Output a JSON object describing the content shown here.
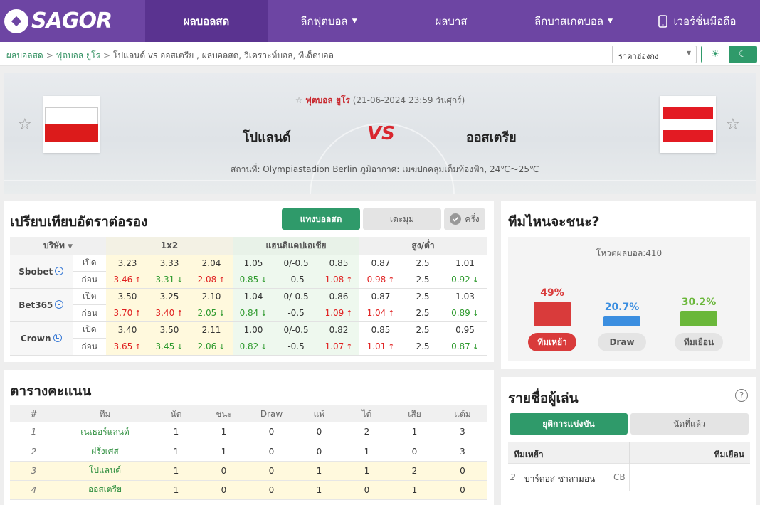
{
  "nav": {
    "logo": "SAGOR",
    "items": [
      {
        "label": "ผลบอลสด",
        "active": true
      },
      {
        "label": "ลีกฟุตบอล",
        "dropdown": true
      },
      {
        "label": "ผลบาส"
      },
      {
        "label": "ลีกบาสเกตบอล",
        "dropdown": true
      },
      {
        "label": "เวอร์ชั่นมือถือ",
        "icon": "phone-icon"
      }
    ]
  },
  "breadcrumb": [
    "ผลบอลสด",
    "ฟุตบอล ยูโร",
    "โปแลนด์ vs  ออสเตรีย ,  ผลบอลสด,  วิเคราะห์บอล,  ทีเด็ดบอล"
  ],
  "price_select": {
    "value": "ราคาฮ่องกง"
  },
  "theme_toggle": {
    "light_icon": "sun-icon",
    "dark_icon": "moon-icon"
  },
  "match": {
    "league": "ฟุตบอล ยูโร",
    "datetime": "(21-06-2024 23:59 วันศุกร์)",
    "home": "โปแลนด์",
    "away": "ออสเตรีย",
    "vs": "VS",
    "venue": "สถานที่: Olympiastadion Berlin",
    "weather": "ภูมิอากาศ: เมฆปกคลุมเต็มท้องฟ้า, 24℃～25℃",
    "home_flag_colors": [
      "#ffffff",
      "#dc1b1b"
    ],
    "away_flag_colors": [
      "#e31b23",
      "#ffffff",
      "#e31b23"
    ]
  },
  "odds": {
    "title": "เปรียบเทียบอัตราต่อรอง",
    "buttons": {
      "live": "แทงบอลสด",
      "hidden": "เดะมุม",
      "half": "ครึ่ง"
    },
    "headers": {
      "company": "บริษัท",
      "x12": "1x2",
      "handicap": "แฮนดิแคปเอเชีย",
      "ou": "สูง/ต่ำ"
    },
    "row_labels": {
      "open": "เปิด",
      "before": "ก่อน"
    },
    "books": [
      {
        "name": "Sbobet",
        "open": [
          "3.23",
          "3.33",
          "2.04",
          "1.05",
          "0/-0.5",
          "0.85",
          "0.87",
          "2.5",
          "1.01"
        ],
        "before": [
          "3.46",
          "3.31",
          "2.08",
          "0.85",
          "-0.5",
          "1.08",
          "0.98",
          "2.5",
          "0.92"
        ],
        "before_dir": [
          "up",
          "dn",
          "up",
          "dn",
          "",
          "up",
          "up",
          "",
          "dn"
        ]
      },
      {
        "name": "Bet365",
        "open": [
          "3.50",
          "3.25",
          "2.10",
          "1.04",
          "0/-0.5",
          "0.86",
          "0.87",
          "2.5",
          "1.03"
        ],
        "before": [
          "3.70",
          "3.40",
          "2.05",
          "0.84",
          "-0.5",
          "1.09",
          "1.04",
          "2.5",
          "0.89"
        ],
        "before_dir": [
          "up",
          "up",
          "dn",
          "dn",
          "",
          "up",
          "up",
          "",
          "dn"
        ]
      },
      {
        "name": "Crown",
        "open": [
          "3.40",
          "3.50",
          "2.11",
          "1.00",
          "0/-0.5",
          "0.82",
          "0.85",
          "2.5",
          "0.95"
        ],
        "before": [
          "3.65",
          "3.45",
          "2.06",
          "0.82",
          "-0.5",
          "1.07",
          "1.01",
          "2.5",
          "0.87"
        ],
        "before_dir": [
          "up",
          "dn",
          "dn",
          "dn",
          "",
          "up",
          "up",
          "",
          "dn"
        ]
      }
    ]
  },
  "prediction": {
    "title": "ทีมไหนจะชนะ?",
    "votes_label": "โหวตผลบอล:410",
    "home": {
      "pct": "49%",
      "value": 0.49,
      "label": "ทีมเหย้า",
      "color": "#d93b3b"
    },
    "draw": {
      "pct": "20.7%",
      "value": 0.207,
      "label": "Draw",
      "color": "#3b8ee0"
    },
    "away": {
      "pct": "30.2%",
      "value": 0.302,
      "label": "ทีมเยือน",
      "color": "#6ab73a"
    }
  },
  "standings": {
    "title": "ตารางคะแนน",
    "headers": [
      "#",
      "ทีม",
      "นัด",
      "ชนะ",
      "Draw",
      "แพ้",
      "ได้",
      "เสีย",
      "แต้ม"
    ],
    "rows": [
      {
        "rank": "1",
        "team": "เนเธอร์แลนด์",
        "p": "1",
        "w": "1",
        "d": "0",
        "l": "0",
        "gf": "2",
        "ga": "1",
        "pts": "3"
      },
      {
        "rank": "2",
        "team": "ฝรั่งเศส",
        "p": "1",
        "w": "1",
        "d": "0",
        "l": "0",
        "gf": "1",
        "ga": "0",
        "pts": "3"
      },
      {
        "rank": "3",
        "team": "โปแลนด์",
        "p": "1",
        "w": "0",
        "d": "0",
        "l": "1",
        "gf": "1",
        "ga": "2",
        "pts": "0"
      },
      {
        "rank": "4",
        "team": "ออสเตรีย",
        "p": "1",
        "w": "0",
        "d": "0",
        "l": "1",
        "gf": "0",
        "ga": "1",
        "pts": "0"
      }
    ]
  },
  "players": {
    "title": "รายชื่อผู้เล่น",
    "tabs": [
      "ยุติการแข่งขัน",
      "นัดที่แล้ว"
    ],
    "home_label": "ทีมเหย้า",
    "away_label": "ทีมเยือน",
    "rows": [
      {
        "no": "2",
        "name": "บาร์ตอส ซาลามอน",
        "pos": "CB"
      }
    ]
  }
}
